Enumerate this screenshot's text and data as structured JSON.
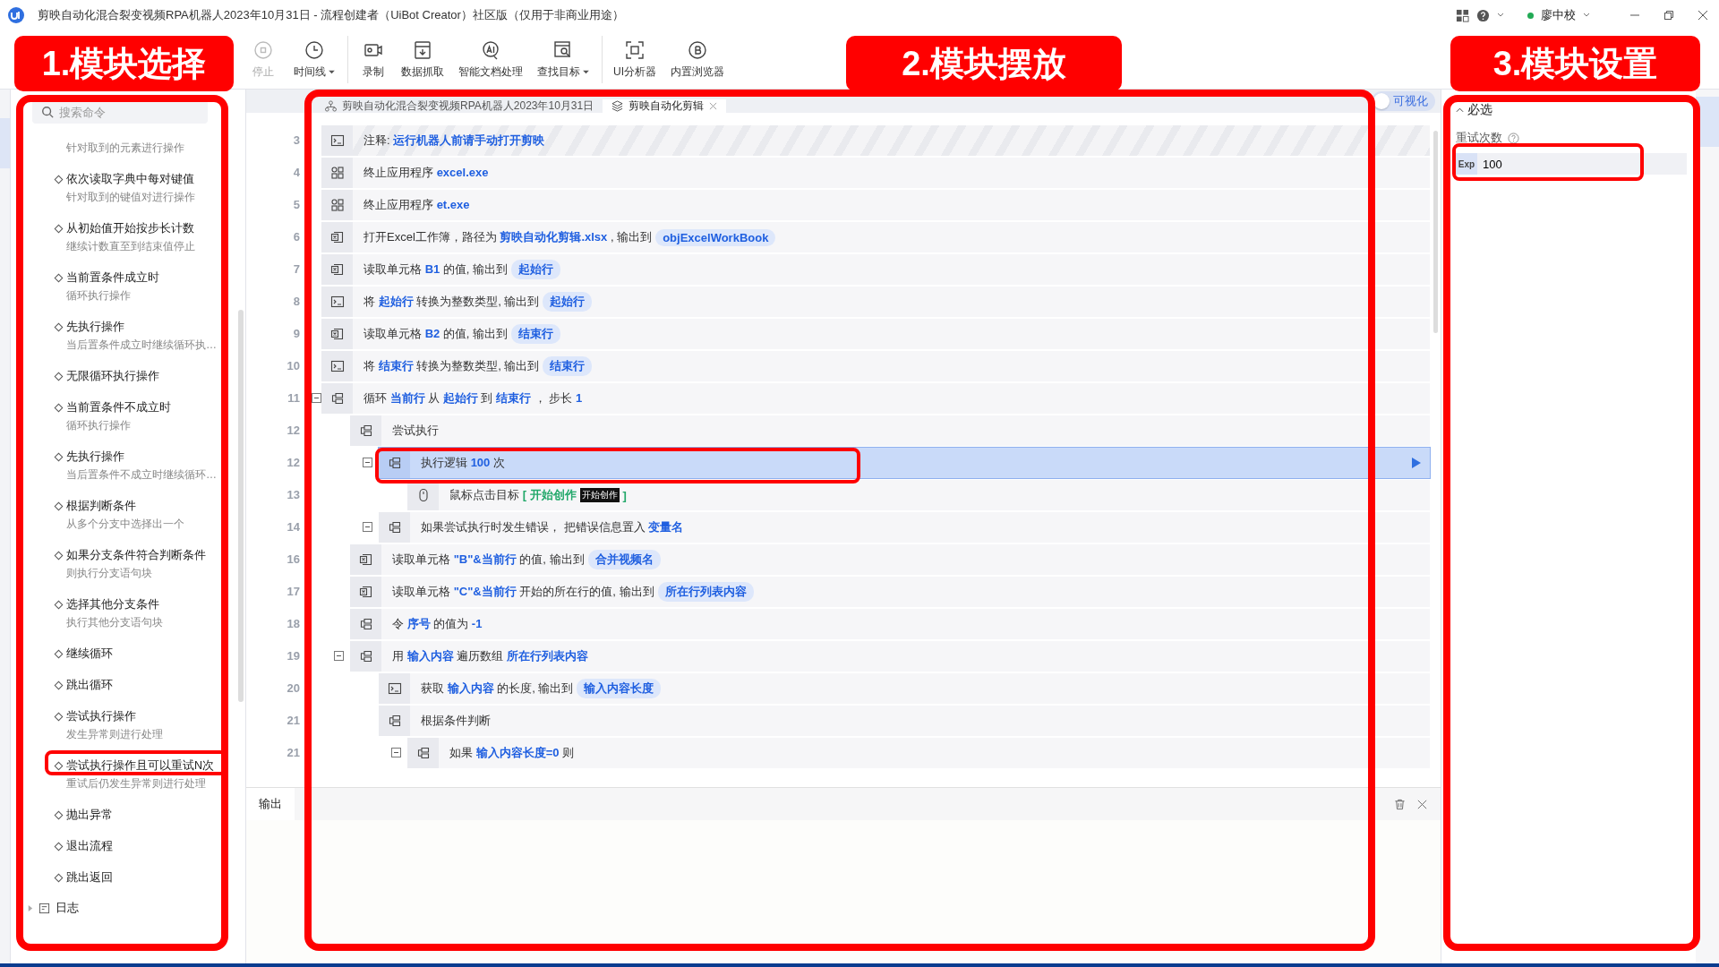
{
  "window": {
    "title": "剪映自动化混合裂变视频RPA机器人2023年10月31日 - 流程创建者（UiBot Creator）社区版（仅用于非商业用途）",
    "user": "廖中校"
  },
  "toolbar": {
    "items": [
      {
        "label": "停止",
        "kind": "stop",
        "disabled": true,
        "dropdown": false,
        "separator_before": false
      },
      {
        "label": "时间线",
        "kind": "clock",
        "disabled": false,
        "dropdown": true,
        "separator_before": false
      },
      {
        "label": "录制",
        "kind": "record",
        "disabled": false,
        "dropdown": false,
        "separator_before": true
      },
      {
        "label": "数据抓取",
        "kind": "capture",
        "disabled": false,
        "dropdown": false,
        "separator_before": false
      },
      {
        "label": "智能文档处理",
        "kind": "ai",
        "disabled": false,
        "dropdown": false,
        "separator_before": false
      },
      {
        "label": "查找目标",
        "kind": "find",
        "disabled": false,
        "dropdown": true,
        "separator_before": false
      },
      {
        "label": "UI分析器",
        "kind": "ui",
        "disabled": false,
        "dropdown": false,
        "separator_before": true
      },
      {
        "label": "内置浏览器",
        "kind": "browser",
        "disabled": false,
        "dropdown": false,
        "separator_before": false
      }
    ]
  },
  "annotations": [
    "1.模块选择",
    "2.模块摆放",
    "3.模块设置"
  ],
  "commands": {
    "search": {
      "placeholder": "搜索命令"
    },
    "items": [
      {
        "desc": "针对取到的元素进行操作"
      },
      {
        "title": "依次读取字典中每对键值",
        "desc": "针对取到的键值对进行操作"
      },
      {
        "title": "从初始值开始按步长计数",
        "desc": "继续计数直至到结束值停止"
      },
      {
        "title": "当前置条件成立时",
        "desc": "循环执行操作"
      },
      {
        "title": "先执行操作",
        "desc": "当后置条件成立时继续循环执…"
      },
      {
        "title": "无限循环执行操作"
      },
      {
        "title": "当前置条件不成立时",
        "desc": "循环执行操作"
      },
      {
        "title": "先执行操作",
        "desc": "当后置条件不成立时继续循环…"
      },
      {
        "title": "根据判断条件",
        "desc": "从多个分支中选择出一个"
      },
      {
        "title": "如果分支条件符合判断条件",
        "desc": "则执行分支语句块"
      },
      {
        "title": "选择其他分支条件",
        "desc": "执行其他分支语句块"
      },
      {
        "title": "继续循环"
      },
      {
        "title": "跳出循环"
      },
      {
        "title": "尝试执行操作",
        "desc": "发生异常则进行处理"
      },
      {
        "title": "尝试执行操作且可以重试N次",
        "desc": "重试后仍发生异常则进行处理"
      },
      {
        "title": "抛出异常"
      },
      {
        "title": "退出流程"
      },
      {
        "title": "跳出返回"
      }
    ],
    "group": {
      "label": "日志",
      "expanded": false
    }
  },
  "editor": {
    "tabs": [
      {
        "label": "剪映自动化混合裂变视频RPA机器人2023年10月31日",
        "selected": false,
        "closable": false
      },
      {
        "label": "剪映自动化剪辑",
        "selected": true,
        "closable": true
      }
    ],
    "visual_toggle": {
      "label": "可视化",
      "on": false
    },
    "rows": [
      {
        "line": "3",
        "kind": "comment",
        "selected": false,
        "parts": [
          {
            "kind": "text",
            "text": "注释: "
          },
          {
            "kind": "var",
            "text": "运行机器人前请手动打开剪映"
          }
        ]
      },
      {
        "line": "4",
        "kind": "app",
        "selected": false,
        "parts": [
          {
            "kind": "text",
            "text": "终止应用程序 "
          },
          {
            "kind": "var",
            "text": "excel.exe"
          }
        ]
      },
      {
        "line": "5",
        "kind": "app",
        "selected": false,
        "parts": [
          {
            "kind": "text",
            "text": "终止应用程序 "
          },
          {
            "kind": "var",
            "text": "et.exe"
          }
        ]
      },
      {
        "line": "6",
        "kind": "excel",
        "selected": false,
        "parts": [
          {
            "kind": "text",
            "text": "打开Excel工作簿，路径为 "
          },
          {
            "kind": "var",
            "text": "剪映自动化剪辑.xlsx"
          },
          {
            "kind": "text",
            "text": " , 输出到 "
          },
          {
            "kind": "chip",
            "text": "objExcelWorkBook"
          }
        ]
      },
      {
        "line": "7",
        "kind": "excel",
        "selected": false,
        "parts": [
          {
            "kind": "text",
            "text": "读取单元格 "
          },
          {
            "kind": "var",
            "text": "B1"
          },
          {
            "kind": "text",
            "text": " 的值, 输出到 "
          },
          {
            "kind": "chip",
            "text": "起始行"
          }
        ]
      },
      {
        "line": "8",
        "kind": "code",
        "selected": false,
        "parts": [
          {
            "kind": "text",
            "text": "将 "
          },
          {
            "kind": "var",
            "text": "起始行"
          },
          {
            "kind": "text",
            "text": " 转换为整数类型, 输出到 "
          },
          {
            "kind": "chip",
            "text": "起始行"
          }
        ]
      },
      {
        "line": "9",
        "kind": "excel",
        "selected": false,
        "parts": [
          {
            "kind": "text",
            "text": "读取单元格 "
          },
          {
            "kind": "var",
            "text": "B2"
          },
          {
            "kind": "text",
            "text": " 的值, 输出到 "
          },
          {
            "kind": "chip",
            "text": "结束行"
          }
        ]
      },
      {
        "line": "10",
        "kind": "code",
        "selected": false,
        "parts": [
          {
            "kind": "text",
            "text": "将 "
          },
          {
            "kind": "var",
            "text": "结束行"
          },
          {
            "kind": "text",
            "text": " 转换为整数类型, 输出到 "
          },
          {
            "kind": "chip",
            "text": "结束行"
          }
        ]
      },
      {
        "line": "11",
        "kind": "block",
        "selected": false,
        "expanded": true,
        "parts": [
          {
            "kind": "text",
            "text": "循环 "
          },
          {
            "kind": "var",
            "text": "当前行"
          },
          {
            "kind": "text",
            "text": " 从 "
          },
          {
            "kind": "var",
            "text": "起始行"
          },
          {
            "kind": "text",
            "text": " 到 "
          },
          {
            "kind": "var",
            "text": "结束行"
          },
          {
            "kind": "text",
            "text": " ， 步长 "
          },
          {
            "kind": "var",
            "text": "1"
          }
        ],
        "children": [
          {
            "line": "12",
            "kind": "block",
            "selected": false,
            "parts": [
              {
                "kind": "text",
                "text": "尝试执行"
              }
            ],
            "children": [
              {
                "line": "12",
                "kind": "block",
                "selected": true,
                "expanded": true,
                "parts": [
                  {
                    "kind": "text",
                    "text": "执行逻辑 "
                  },
                  {
                    "kind": "var",
                    "text": "100"
                  },
                  {
                    "kind": "text",
                    "text": " 次"
                  }
                ],
                "children": [
                  {
                    "line": "13",
                    "kind": "mouse",
                    "selected": false,
                    "parts": [
                      {
                        "kind": "text",
                        "text": "鼠标点击目标 "
                      },
                      {
                        "kind": "target",
                        "text": "[ 开始创作 "
                      },
                      {
                        "kind": "thumb",
                        "text": "开始创作"
                      },
                      {
                        "kind": "target",
                        "text": " ]"
                      }
                    ]
                  }
                ]
              },
              {
                "line": "14",
                "kind": "block",
                "selected": false,
                "expanded": true,
                "parts": [
                  {
                    "kind": "text",
                    "text": "如果尝试执行时发生错误， 把错误信息置入 "
                  },
                  {
                    "kind": "var",
                    "text": "变量名"
                  }
                ]
              }
            ]
          },
          {
            "line": "16",
            "kind": "excel",
            "selected": false,
            "parts": [
              {
                "kind": "text",
                "text": "读取单元格 "
              },
              {
                "kind": "var",
                "text": "\"B\"&当前行"
              },
              {
                "kind": "text",
                "text": " 的值, 输出到 "
              },
              {
                "kind": "chip",
                "text": "合并视频名"
              }
            ]
          },
          {
            "line": "17",
            "kind": "excel",
            "selected": false,
            "parts": [
              {
                "kind": "text",
                "text": "读取单元格 "
              },
              {
                "kind": "var",
                "text": "\"C\"&当前行"
              },
              {
                "kind": "text",
                "text": " 开始的所在行的值, 输出到 "
              },
              {
                "kind": "chip",
                "text": "所在行列表内容"
              }
            ]
          },
          {
            "line": "18",
            "kind": "block",
            "selected": false,
            "parts": [
              {
                "kind": "text",
                "text": "令 "
              },
              {
                "kind": "var",
                "text": "序号"
              },
              {
                "kind": "text",
                "text": " 的值为 "
              },
              {
                "kind": "var",
                "text": "-1"
              }
            ]
          },
          {
            "line": "19",
            "kind": "block",
            "selected": false,
            "expanded": true,
            "parts": [
              {
                "kind": "text",
                "text": "用 "
              },
              {
                "kind": "var",
                "text": "输入内容"
              },
              {
                "kind": "text",
                "text": " 遍历数组 "
              },
              {
                "kind": "var",
                "text": "所在行列表内容"
              }
            ],
            "children": [
              {
                "line": "20",
                "kind": "code",
                "selected": false,
                "parts": [
                  {
                    "kind": "text",
                    "text": "获取 "
                  },
                  {
                    "kind": "var",
                    "text": "输入内容"
                  },
                  {
                    "kind": "text",
                    "text": " 的长度, 输出到 "
                  },
                  {
                    "kind": "chip",
                    "text": "输入内容长度"
                  }
                ]
              },
              {
                "line": "21",
                "kind": "block",
                "selected": false,
                "parts": [
                  {
                    "kind": "text",
                    "text": "根据条件判断"
                  }
                ],
                "children": [
                  {
                    "line": "21",
                    "kind": "block",
                    "selected": false,
                    "expanded": true,
                    "parts": [
                      {
                        "kind": "text",
                        "text": "如果 "
                      },
                      {
                        "kind": "var",
                        "text": "输入内容长度=0"
                      },
                      {
                        "kind": "text",
                        "text": " 则"
                      }
                    ]
                  }
                ]
              }
            ]
          }
        ]
      }
    ]
  },
  "output": {
    "tab": "输出"
  },
  "settings": {
    "section": {
      "title": "必选",
      "expanded": true
    },
    "field": {
      "label": "重试次数",
      "badge": "Exp",
      "value": "100"
    }
  }
}
